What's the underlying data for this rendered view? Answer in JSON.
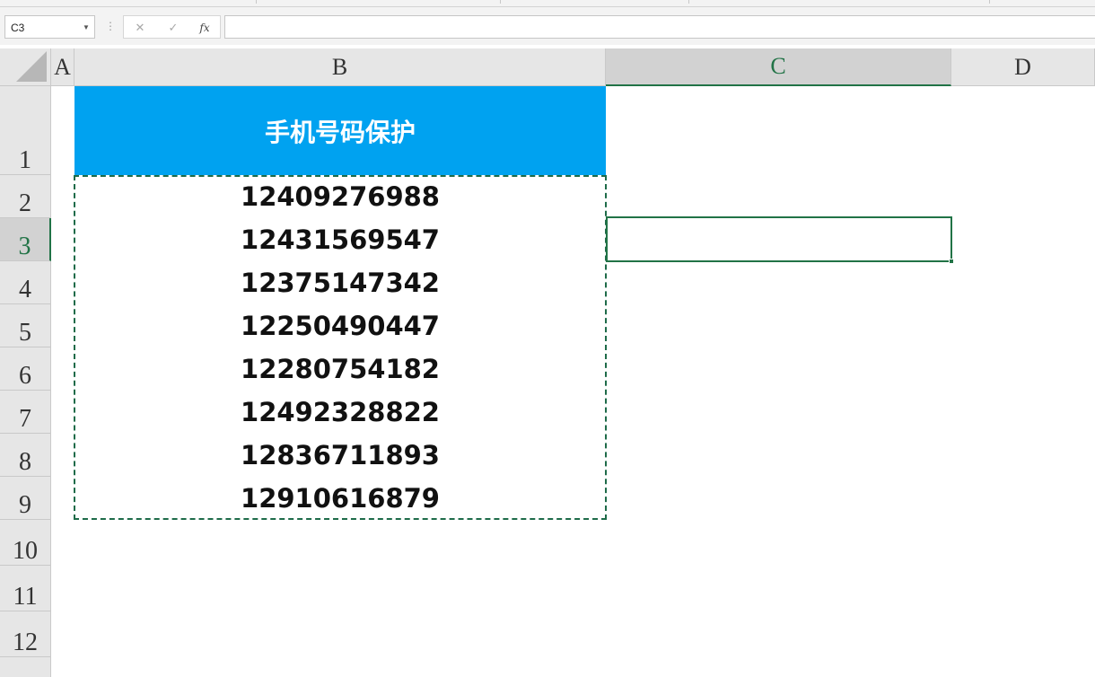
{
  "formula_bar": {
    "name_box": "C3",
    "cancel_symbol": "✕",
    "enter_symbol": "✓",
    "fx_symbol": "fx",
    "formula_value": ""
  },
  "columns": [
    {
      "label": "A",
      "selected": false
    },
    {
      "label": "B",
      "selected": false
    },
    {
      "label": "C",
      "selected": true
    },
    {
      "label": "D",
      "selected": false
    }
  ],
  "rows": [
    "1",
    "2",
    "3",
    "4",
    "5",
    "6",
    "7",
    "8",
    "9",
    "10",
    "11",
    "12"
  ],
  "selected_row": "3",
  "sheet": {
    "header": "手机号码保护",
    "phone_numbers": [
      "12409276988",
      "12431569547",
      "12375147342",
      "12250490447",
      "12280754182",
      "12492328822",
      "12836711893",
      "12910616879"
    ]
  },
  "colors": {
    "header_fill": "#00a2f0",
    "header_text": "#ffffff",
    "selection_accent": "#217346",
    "marquee": "#1e6b49"
  }
}
